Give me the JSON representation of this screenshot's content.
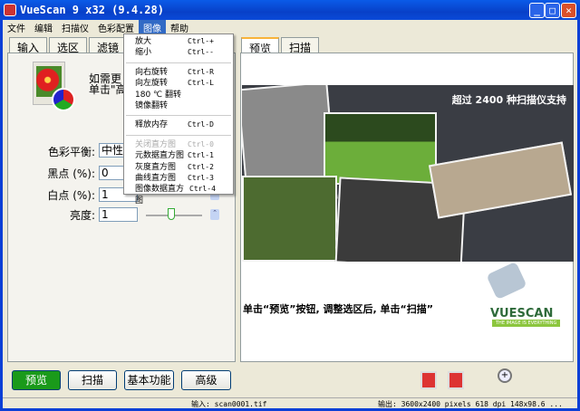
{
  "title": "VueScan 9 x32 (9.4.28)",
  "menu": [
    "文件",
    "编辑",
    "扫描仪",
    "色彩配置",
    "图像",
    "帮助"
  ],
  "dropdown": [
    {
      "label": "放大",
      "shortcut": "Ctrl-+"
    },
    {
      "label": "缩小",
      "shortcut": "Ctrl--"
    },
    {
      "label": "向右旋转",
      "shortcut": "Ctrl-R"
    },
    {
      "label": "向左旋转",
      "shortcut": "Ctrl-L"
    },
    {
      "label": "180 ℃ 翻转",
      "shortcut": ""
    },
    {
      "label": "镜像翻转",
      "shortcut": ""
    },
    {
      "label": "释放内存",
      "shortcut": "Ctrl-D"
    },
    {
      "label": "关闭直方图",
      "shortcut": "Ctrl-0"
    },
    {
      "label": "元数据直方图",
      "shortcut": "Ctrl-1"
    },
    {
      "label": "灰度直方图",
      "shortcut": "Ctrl-2"
    },
    {
      "label": "曲线直方图",
      "shortcut": "Ctrl-3"
    },
    {
      "label": "图像数据直方图",
      "shortcut": "Ctrl-4"
    }
  ],
  "left_tabs": [
    "输入",
    "选区",
    "滤镜"
  ],
  "right_tabs": [
    "预览",
    "扫描"
  ],
  "hint": [
    "如需更",
    "单击\"高"
  ],
  "fields": {
    "color_balance": {
      "label": "色彩平衡:",
      "value": "中性"
    },
    "black_point": {
      "label": "黑点 (%):",
      "value": "0"
    },
    "white_point": {
      "label": "白点 (%):",
      "value": "1"
    },
    "brightness": {
      "label": "亮度:",
      "value": "1"
    }
  },
  "preview": {
    "banner": "超过 2400 种扫描仪支持",
    "instruction": "单击“预览”按钮, 调整选区后, 单击“扫描”",
    "logo": "VUESCAN",
    "logo_tagline": "THE IMAGE IS EVERYTHING"
  },
  "buttons": {
    "preview": "预览",
    "scan": "扫描",
    "basic": "基本功能",
    "advanced": "高级"
  },
  "status": {
    "input": "输入: scan0001.tif",
    "output": "输出: 3600x2400 pixels 618 dpi 148x98.6 ..."
  }
}
